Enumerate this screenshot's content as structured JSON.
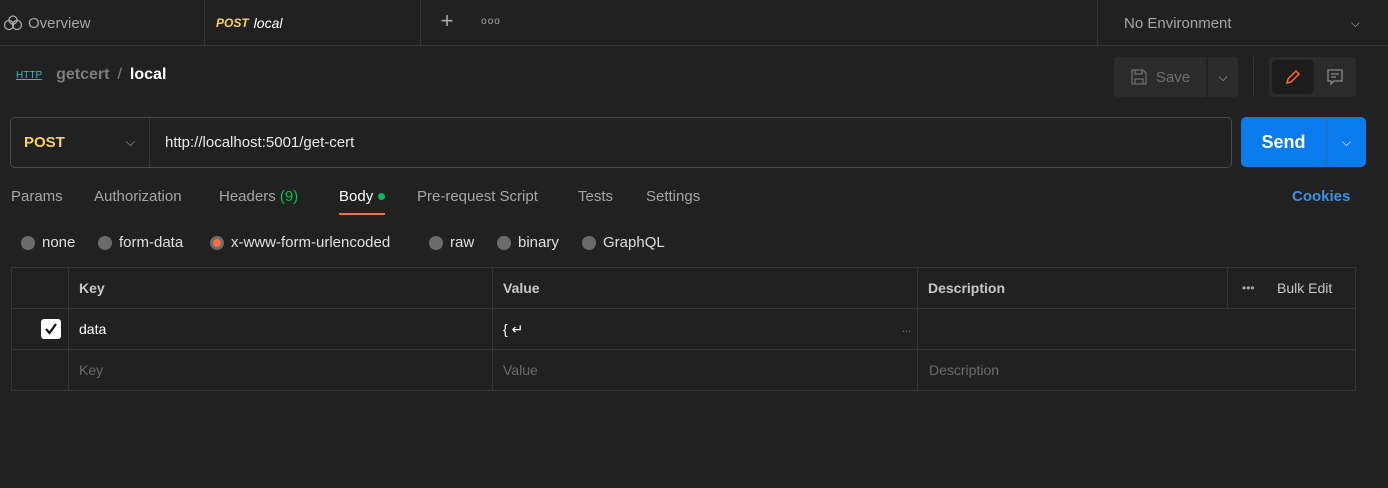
{
  "tabs": [
    {
      "label": "Overview",
      "icon": "overview-icon"
    },
    {
      "method": "POST",
      "label": "local",
      "active": true
    }
  ],
  "environment": "No Environment",
  "breadcrumb": {
    "collection": "getcert",
    "separator": "/",
    "request": "local"
  },
  "toolbar": {
    "save_label": "Save"
  },
  "request": {
    "method": "POST",
    "url": "http://localhost:5001/get-cert",
    "send_label": "Send"
  },
  "nav": {
    "params": "Params",
    "authorization": "Authorization",
    "headers": "Headers",
    "headers_count": "(9)",
    "body": "Body",
    "prerequest": "Pre-request Script",
    "tests": "Tests",
    "settings": "Settings",
    "cookies": "Cookies"
  },
  "body_types": [
    "none",
    "form-data",
    "x-www-form-urlencoded",
    "raw",
    "binary",
    "GraphQL"
  ],
  "body_type_selected": "x-www-form-urlencoded",
  "table": {
    "headers": {
      "key": "Key",
      "value": "Value",
      "description": "Description",
      "bulk_edit": "Bulk Edit"
    },
    "rows": [
      {
        "checked": true,
        "key": "data",
        "value": "{ ↵",
        "description": ""
      }
    ],
    "placeholders": {
      "key": "Key",
      "value": "Value",
      "description": "Description"
    }
  },
  "colors": {
    "accent": "#ff6c37",
    "send": "#097bed",
    "method": "#f4d35e",
    "link": "#3d8fe8",
    "dot": "#0cbb52"
  }
}
